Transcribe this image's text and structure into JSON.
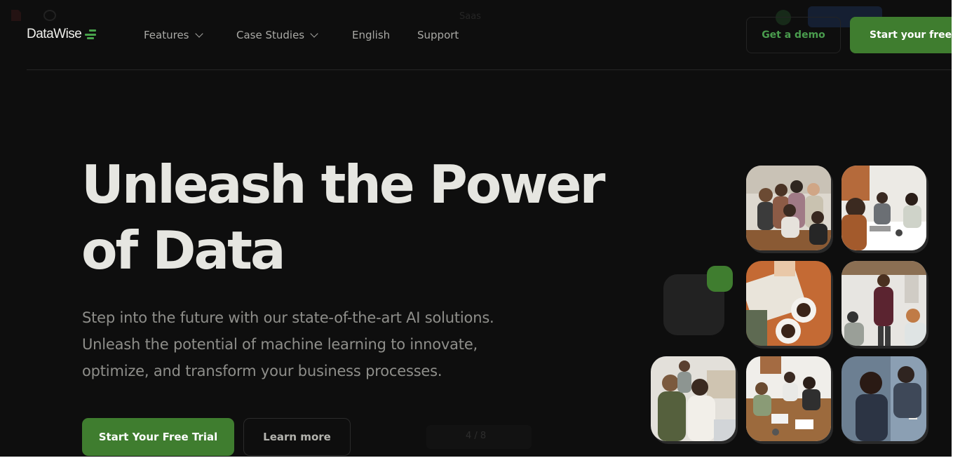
{
  "brand": {
    "name": "DataWise",
    "logo_icon": "stacked-lines-icon",
    "accent": "#48a24b"
  },
  "background_chrome": {
    "title": "Saas",
    "pager": "4 / 8"
  },
  "nav": {
    "features": "Features",
    "case_studies": "Case Studies",
    "english": "English",
    "support": "Support",
    "demo_button": "Get a demo",
    "trial_button": "Start your free trial"
  },
  "hero": {
    "title_line1": "Unleash the Power",
    "title_line2": "of Data",
    "subtitle_line1": "Step into the future with our state-of-the-art AI solutions.",
    "subtitle_line2": "Unleash the potential of machine learning to innovate,",
    "subtitle_line3": "optimize, and transform your business processes.",
    "primary_button": "Start Your Free Trial",
    "secondary_button": "Learn more"
  },
  "colors": {
    "background": "#0e0e0e",
    "primary_green": "#3f7d2f",
    "heading": "#e6e6e1",
    "body_text": "#8e8e8a"
  },
  "gallery": {
    "images": [
      "team-huddle-photo",
      "meeting-table-photo",
      "coffee-papers-photo",
      "presenter-photo",
      "laughing-colleagues-photo",
      "office-meeting-photo",
      "sticky-notes-photo"
    ]
  }
}
